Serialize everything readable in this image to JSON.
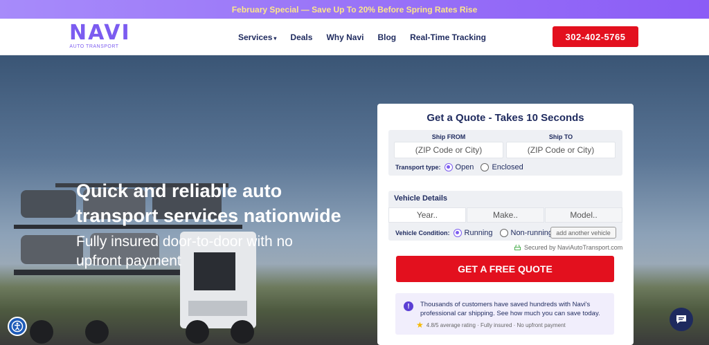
{
  "promo": {
    "text": "February Special — Save Up To 20% Before Spring Rates Rise"
  },
  "brand": {
    "name": "NAVI",
    "tagline": "AUTO TRANSPORT"
  },
  "nav": {
    "items": [
      {
        "label": "Services"
      },
      {
        "label": "Deals"
      },
      {
        "label": "Why Navi"
      },
      {
        "label": "Blog"
      },
      {
        "label": "Real-Time Tracking"
      }
    ],
    "phone": "302-402-5765"
  },
  "hero": {
    "title": "Quick and reliable auto transport services nationwide",
    "subtitle": "Fully insured door-to-door with no upfront payment"
  },
  "quote": {
    "title": "Get a Quote - Takes 10 Seconds",
    "ship_from_label": "Ship FROM",
    "ship_to_label": "Ship TO",
    "ship_from_placeholder": "(ZIP Code or City)",
    "ship_to_placeholder": "(ZIP Code or City)",
    "transport_type_label": "Transport type:",
    "transport_options": [
      "Open",
      "Enclosed"
    ],
    "transport_selected": "Open",
    "vehicle_details_title": "Vehicle Details",
    "year_placeholder": "Year..",
    "make_placeholder": "Make..",
    "model_placeholder": "Model..",
    "vehicle_condition_label": "Vehicle Condition:",
    "condition_options": [
      "Running",
      "Non-running"
    ],
    "condition_selected": "Running",
    "add_vehicle": "add another vehicle",
    "secured": "Secured by NaviAutoTransport.com",
    "cta": "GET A FREE QUOTE",
    "info_text": "Thousands of customers have saved hundreds with Navi's professional car shipping. See how much you can save today.",
    "rating_text": "4.8/5 average rating · Fully insured · No upfront payment"
  },
  "colors": {
    "accent": "#7c5cf0",
    "cta": "#e3101e",
    "navy": "#1e2a5e",
    "promo_text": "#fde68a"
  }
}
